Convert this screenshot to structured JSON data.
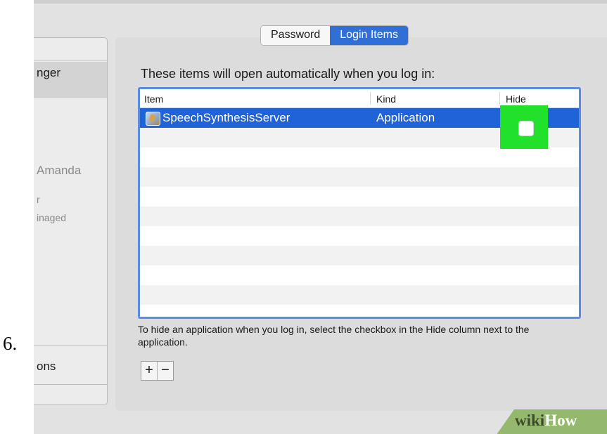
{
  "step_number": "6.",
  "sidebar": {
    "items": [
      {
        "label": "nger"
      },
      {
        "label": "Amanda"
      },
      {
        "label": "r"
      },
      {
        "label": "inaged"
      },
      {
        "label": "ons"
      }
    ]
  },
  "tabs": [
    {
      "label": "Password",
      "active": false
    },
    {
      "label": "Login Items",
      "active": true
    }
  ],
  "heading": "These items will open automatically when you log in:",
  "table": {
    "columns": [
      "Item",
      "Kind",
      "Hide"
    ],
    "rows": [
      {
        "item": "SpeechSynthesisServer",
        "kind": "Application",
        "hide": false,
        "icon": "speech-app-icon"
      }
    ]
  },
  "note": "To hide an application when you log in, select the checkbox in the Hide column next to the application.",
  "buttons": {
    "add": "+",
    "remove": "−"
  },
  "watermark": {
    "part1": "wiki",
    "part2": "How"
  },
  "colors": {
    "selection": "#1f63d6",
    "tab_active": "#2f6fd6",
    "highlight": "#22e12a",
    "table_border": "#5a8de0",
    "watermark_bg": "#94b86c"
  }
}
